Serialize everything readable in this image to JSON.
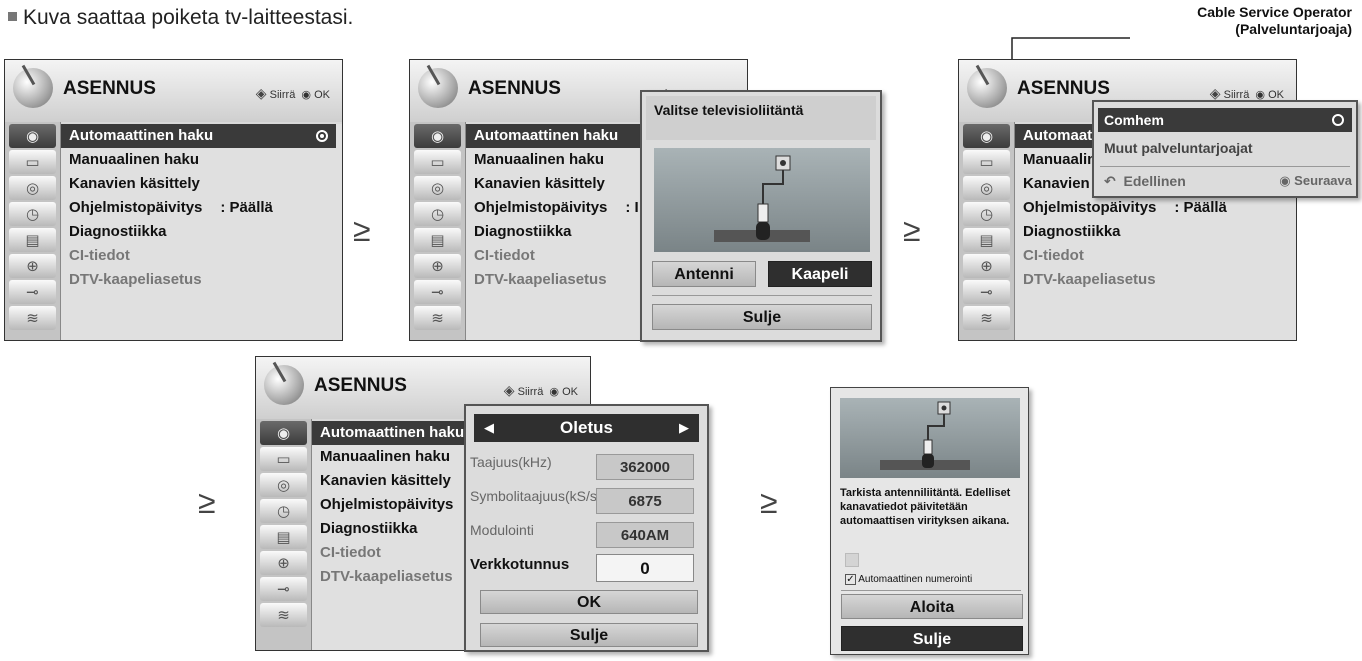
{
  "note": "Kuva saattaa poiketa tv-laitteestasi.",
  "callout": {
    "line1": "Cable Service Operator",
    "line2": "(Palveluntarjoaja)"
  },
  "menu": {
    "title": "ASENNUS",
    "hint_move": "Siirrä",
    "hint_ok": "OK",
    "items": [
      "Automaattinen haku",
      "Manuaalinen haku",
      "Kanavien käsittely",
      "Ohjelmistopäivitys",
      "Diagnostiikka",
      "CI-tiedot",
      "DTV-kaapeliasetus"
    ],
    "update_value": ": Päällä",
    "update_value_cut": ": I"
  },
  "step_arrow": "≥",
  "popup_connection": {
    "title": "Valitse televisioliitäntä",
    "antenna": "Antenni",
    "cable": "Kaapeli",
    "close": "Sulje"
  },
  "popup_operator": {
    "selected": "Comhem",
    "other": "Muut palveluntarjoajat",
    "prev": "Edellinen",
    "next": "Seuraava"
  },
  "popup_settings": {
    "preset": "Oletus",
    "freq_label": "Taajuus(kHz)",
    "freq_value": "362000",
    "symbol_label": "Symbolitaajuus(kS/s)",
    "symbol_value": "6875",
    "mod_label": "Modulointi",
    "mod_value": "640AM",
    "net_label": "Verkkotunnus",
    "net_value": "0",
    "ok": "OK",
    "close": "Sulje"
  },
  "popup_start": {
    "message": "Tarkista antenniliitäntä. Edelliset kanavatiedot päivitetään automaattisen virityksen aikana.",
    "auto_number": "Automaattinen numerointi",
    "start": "Aloita",
    "close": "Sulje"
  }
}
